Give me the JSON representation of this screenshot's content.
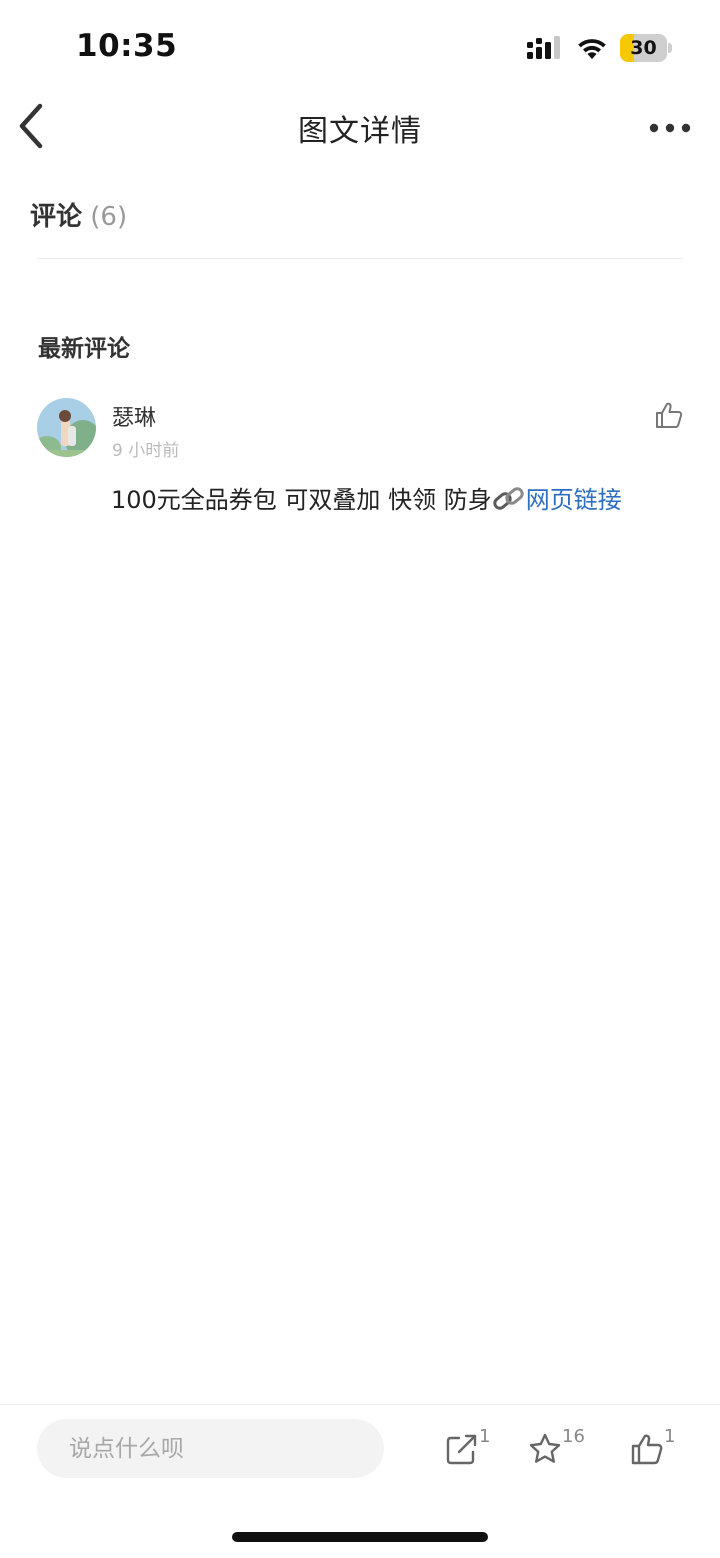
{
  "status_bar": {
    "time": "10:35",
    "battery_level": "30",
    "battery_fraction": 0.3,
    "battery_color": "#f6c800"
  },
  "nav": {
    "title": "图文详情",
    "back_icon": "chevron-left-icon",
    "more_icon": "more-dots-icon"
  },
  "comments": {
    "title": "评论",
    "count": "(6)",
    "section_label": "最新评论",
    "items": [
      {
        "username": "瑟琳",
        "time": "9 小时前",
        "text": "100元全品券包  可双叠加  快领 防身",
        "link_icon": "link-chain-icon",
        "link_text": "网页链接",
        "link_color": "#2f6fbf"
      }
    ]
  },
  "bottom_bar": {
    "input_placeholder": "说点什么呗",
    "share_count": "1",
    "favorite_count": "16",
    "like_count": "1"
  }
}
